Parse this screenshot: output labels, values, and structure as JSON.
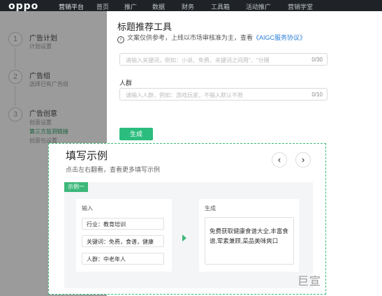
{
  "topnav": {
    "logo": "oppo",
    "brand": "营销平台",
    "items": [
      "首页",
      "推广",
      "数据",
      "财务",
      "工具箱",
      "活动推广",
      "营销学堂"
    ]
  },
  "steps": [
    {
      "num": "1",
      "title": "广告计划",
      "sub": "计划设置"
    },
    {
      "num": "2",
      "title": "广告组",
      "sub": "选择已有广告组"
    },
    {
      "num": "3",
      "title": "广告创意",
      "subs": [
        "创意设置",
        "第三方监测链接",
        "创意包设置"
      ]
    }
  ],
  "drawer": {
    "title": "标题推荐工具",
    "notice_prefix": "文案仅供参考，上线以市场审核准为主，查看",
    "notice_link": "《AIGC服务协议》",
    "keyword_placeholder": "请输入关键词，例如：小说、免费、关键词之间用\"、\"分隔",
    "keyword_count": "0/30",
    "crowd_label": "人群",
    "crowd_placeholder": "请输入人群，例如：游戏玩家，不输入默认不限",
    "crowd_count": "0/10",
    "generate_label": "生成"
  },
  "popup": {
    "title": "填写示例",
    "subtitle": "点击左右翻看，查看更多填写示例",
    "prev_icon": "‹",
    "next_icon": "›",
    "example_tag": "示例一",
    "input_label": "输入",
    "inputs": [
      "行业：教育培训",
      "关键词：免费，食谱，健康",
      "人群：中老年人"
    ],
    "output_label": "生成",
    "output_text": "免费获取健康食谱大全,丰富食谱,荤素兼顾,菜品美味爽口",
    "watermark": "巨宣"
  }
}
